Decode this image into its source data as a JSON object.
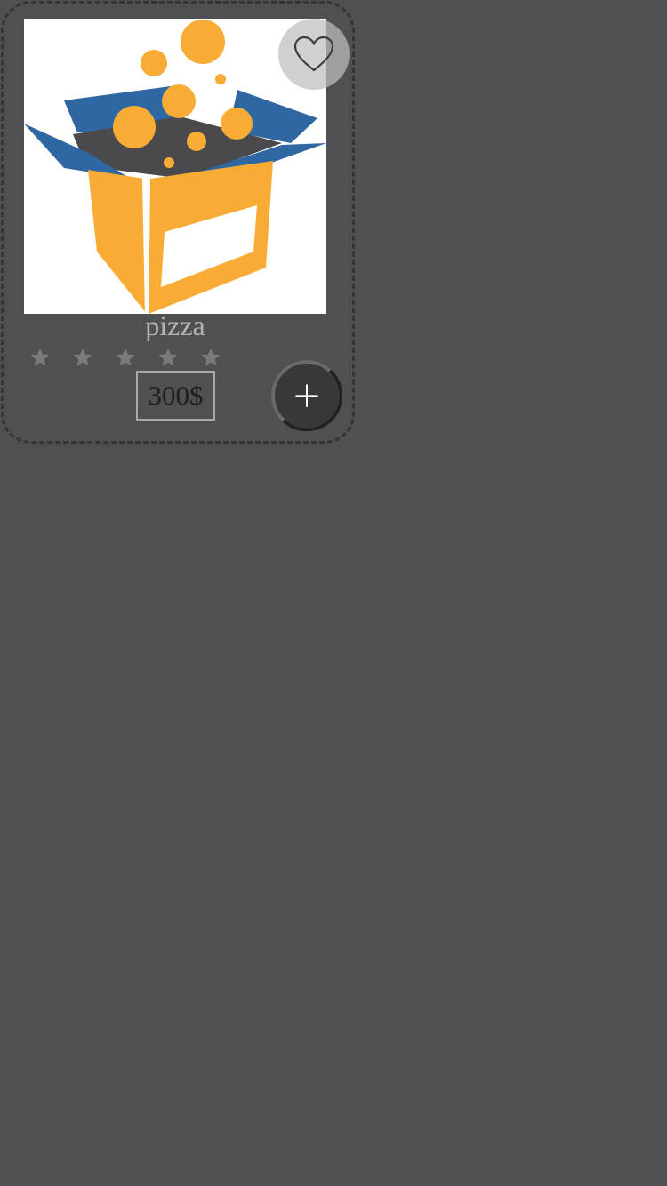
{
  "product": {
    "name": "pizza",
    "price": "300$",
    "rating": 0,
    "max_rating": 5,
    "image_icon": "gift-box-icon"
  },
  "actions": {
    "favorite_icon": "heart-outline-icon",
    "add_label": "+"
  },
  "colors": {
    "background": "#505052",
    "card_border": "#353538",
    "box_orange": "#f8ac35",
    "box_blue": "#2f67a2",
    "box_inner": "#4a4a4c",
    "star_inactive": "#7a7a7a",
    "add_button": "#383839"
  }
}
